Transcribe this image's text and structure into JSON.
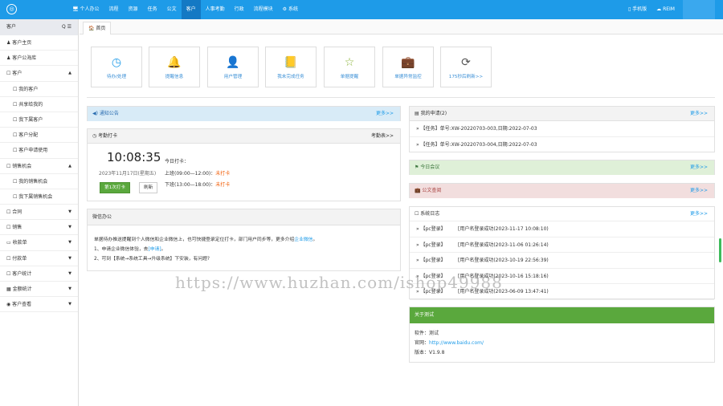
{
  "topbar": {
    "logo": "◎",
    "nav": [
      "🖥 个人办公",
      "流程",
      "资源",
      "任务",
      "公文",
      "客户",
      "人事考勤",
      "行政",
      "流程模块",
      "⚙ 系统"
    ],
    "active_index": 5,
    "right": [
      "▯ 手机版",
      "☁ REIM"
    ]
  },
  "sidebar": {
    "title": "客户",
    "tools": "Q ☰",
    "items": [
      {
        "label": "♟ 客户主页",
        "sub": false,
        "arrow": ""
      },
      {
        "label": "♟ 客户公海库",
        "sub": false,
        "arrow": ""
      },
      {
        "label": "☐ 客户",
        "sub": false,
        "arrow": "▲"
      },
      {
        "label": "☐ 我的客户",
        "sub": true,
        "arrow": ""
      },
      {
        "label": "☐ 共享给我的",
        "sub": true,
        "arrow": ""
      },
      {
        "label": "☐ 我下属客户",
        "sub": true,
        "arrow": ""
      },
      {
        "label": "☐ 客户分配",
        "sub": true,
        "arrow": ""
      },
      {
        "label": "☐ 客户申请使用",
        "sub": true,
        "arrow": ""
      },
      {
        "label": "☐ 销售机会",
        "sub": false,
        "arrow": "▲"
      },
      {
        "label": "☐ 我的销售机会",
        "sub": true,
        "arrow": ""
      },
      {
        "label": "☐ 我下属销售机会",
        "sub": true,
        "arrow": ""
      },
      {
        "label": "☐ 合同",
        "sub": false,
        "arrow": "▼"
      },
      {
        "label": "☐ 销售",
        "sub": false,
        "arrow": "▼"
      },
      {
        "label": "▭ 收款单",
        "sub": false,
        "arrow": "▼"
      },
      {
        "label": "☐ 付款单",
        "sub": false,
        "arrow": "▼"
      },
      {
        "label": "☐ 客户统计",
        "sub": false,
        "arrow": "▼"
      },
      {
        "label": "▦ 金额统计",
        "sub": false,
        "arrow": "▼"
      },
      {
        "label": "◉ 客户查看",
        "sub": false,
        "arrow": "▼"
      }
    ]
  },
  "tab": "🏠 首页",
  "quick": [
    {
      "icon": "◷",
      "label": "待办/处理",
      "color": "#1e9be8"
    },
    {
      "icon": "🔔",
      "label": "提醒信息",
      "color": "#f0ad4e"
    },
    {
      "icon": "👤",
      "label": "用户管理",
      "color": "#1e9be8"
    },
    {
      "icon": "📒",
      "label": "我未完成任务",
      "color": "#8bb33a"
    },
    {
      "icon": "☆",
      "label": "单据提醒",
      "color": "#8bb33a"
    },
    {
      "icon": "💼",
      "label": "单据异常监控",
      "color": "#c9302c"
    },
    {
      "icon": "⟳",
      "label": "175秒后刷新>>",
      "color": "#555"
    }
  ],
  "notice": {
    "title": "◀) 通知公告",
    "more": "更多>>"
  },
  "attendance": {
    "title": "◷ 考勤打卡",
    "more": "考勤表>>",
    "time": "10:08:35",
    "date": "2023年11月17日(星期五)",
    "today": "今日打卡：",
    "am": "上班(09:00—12:00)：",
    "pm": "下班(13:00—18:00)：",
    "status_am": "未打卡",
    "status_pm": "未打卡",
    "btn_punch": "第1次打卡",
    "btn_refresh": "刷新"
  },
  "wechat": {
    "title": "微信办公",
    "line1_pre": "单据待办推送提醒到个人微信和企业微信上，也可快捷登录定位打卡，部门用户同步等，更多介绍",
    "line1_link": "企业微信",
    "line1_post": "。",
    "line2_pre": "1、申请企业微信体验，去",
    "line2_link": "[申请]",
    "line2_post": "。",
    "line3": "2、可到【系统→系统工具→升级系统】下安装，有问题?"
  },
  "apply": {
    "title": "▤ 我的申请(2)",
    "more": "更多>>",
    "items": [
      "» 【任务】单号:XW-20220703-003,日期:2022-07-03",
      "» 【任务】单号:XW-20220703-004,日期:2022-07-03"
    ]
  },
  "meeting": {
    "title": "⚑ 今日会议",
    "more": "更多>>"
  },
  "docs": {
    "title": "💼 公文查阅",
    "more": "更多>>"
  },
  "syslog": {
    "title": "☐ 系统日志",
    "more": "更多>>",
    "rows": [
      {
        "type": "» 【pc登录】",
        "msg": "[用户名登录成功(2023-11-17 10:08:10)"
      },
      {
        "type": "» 【pc登录】",
        "msg": "[用户名登录成功(2023-11-06 01:26:14)"
      },
      {
        "type": "» 【pc登录】",
        "msg": "[用户名登录成功(2023-10-19 22:56:39)"
      },
      {
        "type": "» 【pc登录】",
        "msg": "[用户名登录成功(2023-10-16 15:18:16)"
      },
      {
        "type": "» 【pc登录】",
        "msg": "[用户名登录成功(2023-06-09 13:47:41)"
      }
    ]
  },
  "about": {
    "title": "关于测试",
    "software_label": "软件：",
    "software": "测试",
    "site_label": "官网：",
    "site": "http://www.baidu.com/",
    "version_label": "版本：",
    "version": "V1.9.8"
  },
  "watermark": "https://www.huzhan.com/ishop49988"
}
